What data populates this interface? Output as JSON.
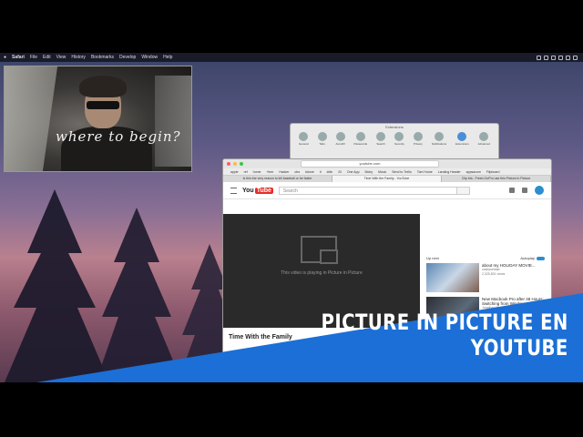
{
  "menubar": {
    "apple": "",
    "app": "Safari",
    "items": [
      "File",
      "Edit",
      "View",
      "History",
      "Bookmarks",
      "Develop",
      "Window",
      "Help"
    ]
  },
  "pip": {
    "caption": "where to begin?"
  },
  "prefs": {
    "title": "Extensions",
    "tabs": [
      "General",
      "Tabs",
      "AutoFill",
      "Passwords",
      "Search",
      "Security",
      "Privacy",
      "Notifications",
      "Extensions",
      "Advanced"
    ]
  },
  "safari": {
    "url": "youtube.com",
    "favorites": [
      "apple",
      "ref",
      "home",
      "+leer",
      "Hacker",
      "obs",
      "#done",
      "ti",
      "#dtv",
      "2/l",
      "One App",
      "Moby",
      "Music",
      "Send to Trello",
      "Tom Home",
      "Landing Header",
      "appsacom",
      "Flipboard"
    ],
    "tabs": [
      "Is this the very reason to kill baseball or be faster",
      "Time With the Family - YouTube",
      "Clip bla - Fresh GoPro use this Picture in Picture"
    ]
  },
  "youtube": {
    "logo_you": "You",
    "logo_tube": "Tube",
    "search_placeholder": "Search",
    "pip_message": "This video is playing in Picture in Picture",
    "video_title": "Time With the Family",
    "up_next": "Up next",
    "autoplay": "Autoplay",
    "related": [
      {
        "title": "about my HOLIDAY MOVIE...",
        "channel": "caseyneistat",
        "views": "2,325,831 views"
      },
      {
        "title": "New Macbook Pro after 48 Hours: Switching from Windows",
        "channel": "Jonathan Morrison",
        "views": ""
      }
    ]
  },
  "banner": {
    "line1": "PICTURE IN PICTURE EN",
    "line2": "YOUTUBE",
    "color": "#1b6fd6"
  }
}
